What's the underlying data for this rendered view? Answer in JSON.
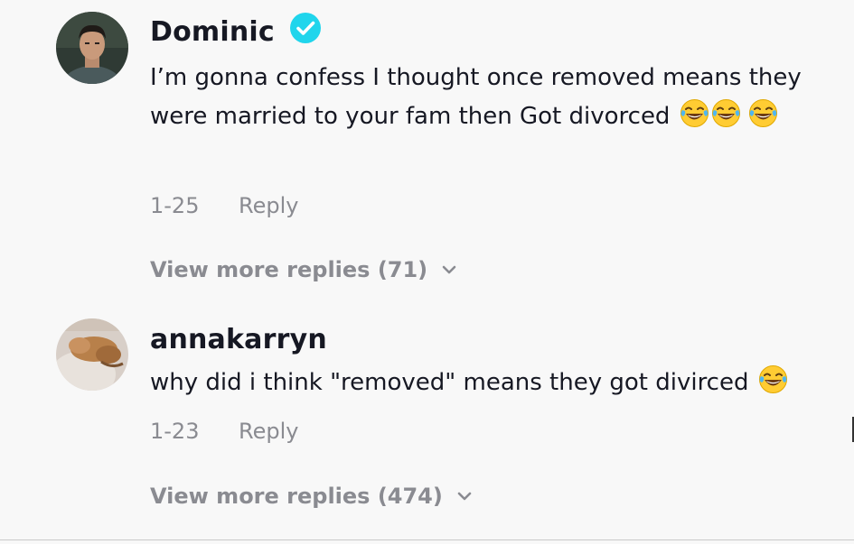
{
  "comments": [
    {
      "username": "Dominic",
      "verified": true,
      "text": "I’m gonna confess I thought once removed means they were married to your fam then Got divorced",
      "emojis": [
        "face-with-tears-of-joy-icon",
        "face-with-tears-of-joy-icon",
        "face-with-tears-of-joy-icon"
      ],
      "date": "1-25",
      "reply_label": "Reply",
      "more_replies_label": "View more replies (71)"
    },
    {
      "username": "annakarryn",
      "verified": false,
      "text": "why did i think \"removed\" means they got divirced",
      "emojis": [
        "face-with-tears-of-joy-icon"
      ],
      "date": "1-23",
      "reply_label": "Reply",
      "more_replies_label": "View more replies (474)"
    }
  ],
  "colors": {
    "background": "#f8f8f8",
    "text_primary": "#161823",
    "text_secondary": "#8a8b91",
    "verified_badge": "#20d5ec"
  }
}
